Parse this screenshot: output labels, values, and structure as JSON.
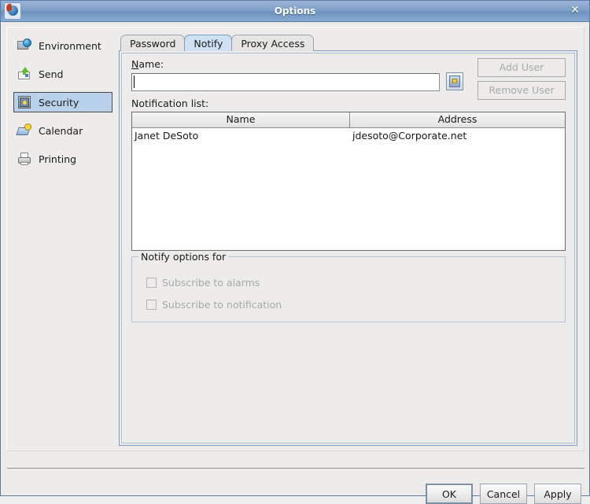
{
  "window": {
    "title": "Options",
    "icon": "app-globe-icon",
    "close_label": "✕"
  },
  "sidebar": {
    "items": [
      {
        "label": "Environment",
        "icon": "monitor-globe-icon",
        "selected": false
      },
      {
        "label": "Send",
        "icon": "envelope-upload-icon",
        "selected": false
      },
      {
        "label": "Security",
        "icon": "safe-lock-icon",
        "selected": true
      },
      {
        "label": "Calendar",
        "icon": "calendar-clock-icon",
        "selected": false
      },
      {
        "label": "Printing",
        "icon": "printer-icon",
        "selected": false
      }
    ]
  },
  "tabs": [
    {
      "label": "Password",
      "active": false
    },
    {
      "label": "Notify",
      "active": true
    },
    {
      "label": "Proxy Access",
      "active": false
    }
  ],
  "notify_panel": {
    "name_label_prefix": "N",
    "name_label_rest": "ame:",
    "name_value": "",
    "name_placeholder": "",
    "address_book_button": "address-book-icon",
    "add_user_label": "Add User",
    "remove_user_label": "Remove User",
    "notification_list_label": "Notification list:",
    "table": {
      "columns": [
        "Name",
        "Address"
      ],
      "rows": [
        [
          "Janet DeSoto",
          "jdesoto@Corporate.net"
        ]
      ]
    },
    "group": {
      "title": "Notify options for",
      "checkboxes": [
        {
          "label": "Subscribe to alarms",
          "checked": false,
          "enabled": false
        },
        {
          "label": "Subscribe to notification",
          "checked": false,
          "enabled": false
        }
      ]
    }
  },
  "footer": {
    "ok_label": "OK",
    "cancel_label": "Cancel",
    "apply_label": "Apply"
  },
  "colors": {
    "titlebar": "#80a0c8",
    "selection": "#b8d2ec",
    "active_tab": "#cfe1f3",
    "panel": "#edecea",
    "disabled_text": "#a8a8a8"
  }
}
